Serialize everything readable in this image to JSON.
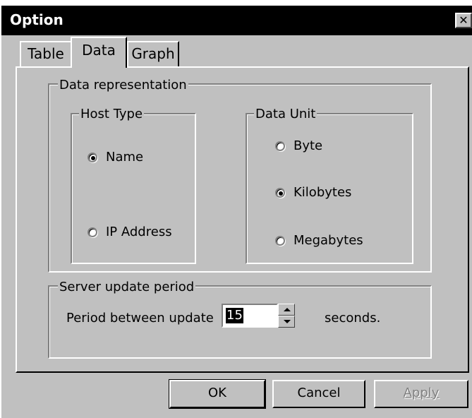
{
  "window": {
    "title": "Option",
    "close_label": "✕"
  },
  "tabs": [
    {
      "label": "Table"
    },
    {
      "label": "Data"
    },
    {
      "label": "Graph"
    }
  ],
  "active_tab": "Data",
  "data_representation": {
    "legend": "Data representation",
    "host_type": {
      "legend": "Host Type",
      "options": [
        {
          "label": "Name",
          "checked": true
        },
        {
          "label": "IP Address",
          "checked": false
        }
      ]
    },
    "data_unit": {
      "legend": "Data Unit",
      "options": [
        {
          "label": "Byte",
          "checked": false
        },
        {
          "label": "Kilobytes",
          "checked": true
        },
        {
          "label": "Megabytes",
          "checked": false
        }
      ]
    }
  },
  "server_update": {
    "legend": "Server update period",
    "period_label": "Period between update",
    "period_value": "15",
    "unit_label": "seconds."
  },
  "buttons": {
    "ok": "OK",
    "cancel": "Cancel",
    "apply": "Apply"
  },
  "colors": {
    "face": "#c0c0c0",
    "titlebar": "#000000",
    "disabled_text": "#808080"
  }
}
